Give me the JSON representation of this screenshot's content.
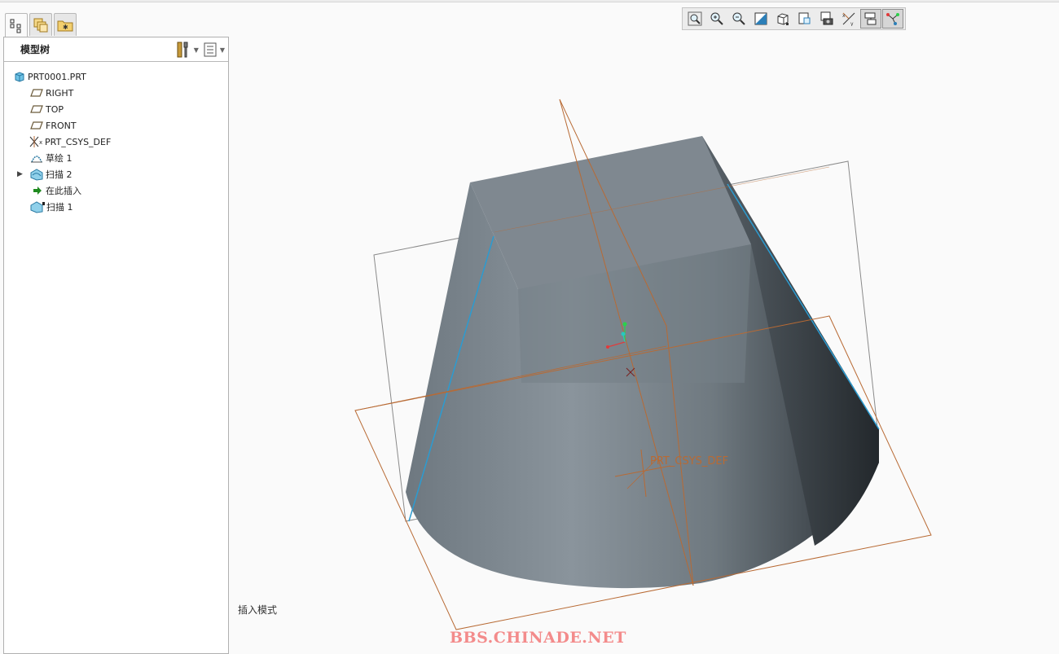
{
  "left_tabs": [
    {
      "icon": "model-tree-tab-icon",
      "active": true
    },
    {
      "icon": "layers-tab-icon",
      "active": false
    },
    {
      "icon": "folder-browser-tab-icon",
      "active": false
    }
  ],
  "model_tree": {
    "title": "模型树",
    "settings_icon": "tree-settings-tools-icon",
    "columns_icon": "tree-columns-list-icon",
    "items": [
      {
        "label": "PRT0001.PRT",
        "icon": "part-cube-icon",
        "level": 0
      },
      {
        "label": "RIGHT",
        "icon": "datum-plane-icon",
        "level": 1
      },
      {
        "label": "TOP",
        "icon": "datum-plane-icon",
        "level": 1
      },
      {
        "label": "FRONT",
        "icon": "datum-plane-icon",
        "level": 1
      },
      {
        "label": "PRT_CSYS_DEF",
        "icon": "coordinate-system-icon",
        "level": 1
      },
      {
        "label": "草绘 1",
        "icon": "sketch-icon",
        "level": 1
      },
      {
        "label": "扫描 2",
        "icon": "sweep-feature-icon",
        "level": 1,
        "expandable": true
      },
      {
        "label": "在此插入",
        "icon": "insert-here-arrow-icon",
        "level": 1
      },
      {
        "label": "扫描 1",
        "icon": "sweep-feature-suppressed-icon",
        "level": 1
      }
    ]
  },
  "view_toolbar": [
    {
      "icon": "zoom-fit-icon"
    },
    {
      "icon": "zoom-in-icon"
    },
    {
      "icon": "zoom-out-icon"
    },
    {
      "icon": "repaint-icon"
    },
    {
      "icon": "display-style-icon"
    },
    {
      "icon": "saved-views-icon"
    },
    {
      "icon": "view-manager-icon"
    },
    {
      "icon": "datum-display-icon"
    },
    {
      "icon": "spin-center-icon",
      "pressed": true
    },
    {
      "icon": "annotation-display-icon",
      "pressed": true
    }
  ],
  "viewport": {
    "csys_label": "PRT_CSYS_DEF",
    "status": "插入模式",
    "watermark": "BBS.CHINADE.NET"
  },
  "colors": {
    "datum_plane": "#b86a34",
    "model_face": "#7d8790",
    "edge_highlight": "#2c9bd0"
  }
}
